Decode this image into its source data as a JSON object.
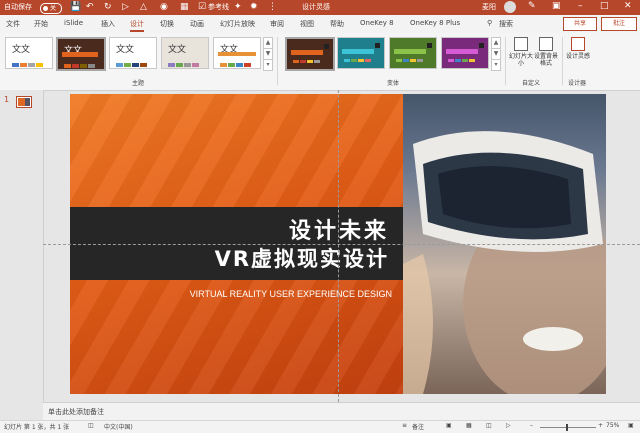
{
  "titlebar": {
    "autosave_label": "自动保存",
    "autosave_state": "关",
    "ref_label": "参考线",
    "doc_title": "设计灵感",
    "user": "麦阳",
    "accent": "#b7472a"
  },
  "tabs": [
    {
      "label": "文件"
    },
    {
      "label": "开始"
    },
    {
      "label": "iSlide"
    },
    {
      "label": "插入"
    },
    {
      "label": "设计",
      "active": true
    },
    {
      "label": "切换"
    },
    {
      "label": "动画"
    },
    {
      "label": "幻灯片放映"
    },
    {
      "label": "审阅"
    },
    {
      "label": "视图"
    },
    {
      "label": "帮助"
    },
    {
      "label": "OneKey 8"
    },
    {
      "label": "OneKey 8 Plus"
    }
  ],
  "search": {
    "placeholder": "搜索"
  },
  "share_label": "共享",
  "comment_label": "批注",
  "ribbon": {
    "theme_text": "文文",
    "themes_group": "主题",
    "variants_group": "变体",
    "customize_group": "自定义",
    "designer_group": "设计器",
    "slide_size_label": "幻灯片大小",
    "format_bg_label": "设置背景格式",
    "design_ideas_label": "设计灵感"
  },
  "slides_pane": {
    "number": "1"
  },
  "slide": {
    "title1": "设计未来",
    "title2": "VR虚拟现实设计",
    "subtitle": "VIRTUAL REALITY USER EXPERIENCE DESIGN"
  },
  "notes_placeholder": "单击此处添加备注",
  "status": {
    "slide_info": "幻灯片 第 1 张，共 1 张",
    "language": "中文(中国)",
    "notes_btn": "备注",
    "zoom": "75%"
  }
}
